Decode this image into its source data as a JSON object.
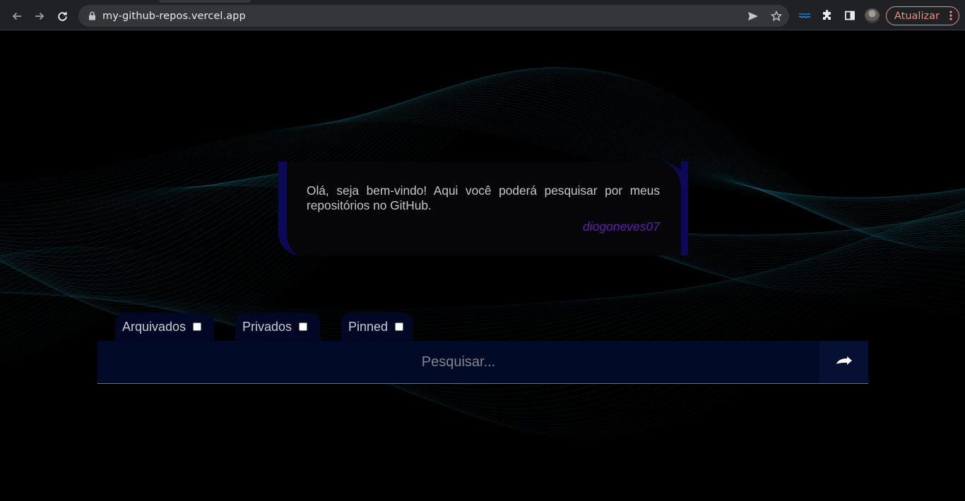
{
  "browser": {
    "url": "my-github-repos.vercel.app",
    "update_label": "Atualizar",
    "icons": [
      "back-arrow-icon",
      "forward-arrow-icon",
      "reload-icon",
      "lock-icon",
      "send-icon",
      "star-icon",
      "extension-wave-icon",
      "puzzle-icon",
      "side-panel-icon",
      "profile-avatar",
      "kebab-menu-icon"
    ],
    "update_color": "#f28b82"
  },
  "welcome": {
    "message": "Olá, seja bem-vindo! Aqui você poderá pesquisar por meus repositórios no GitHub.",
    "author": "diogoneves07"
  },
  "filters": [
    {
      "label": "Arquivados",
      "checked": false
    },
    {
      "label": "Privados",
      "checked": false
    },
    {
      "label": "Pinned",
      "checked": false
    }
  ],
  "search": {
    "placeholder": "Pesquisar...",
    "submit_icon": "➥"
  },
  "colors": {
    "background": "#000000",
    "wave": "#2aa6c2",
    "card_accent": "#0c0a57",
    "author": "#5e22a8",
    "search_bg": "#010a26"
  }
}
